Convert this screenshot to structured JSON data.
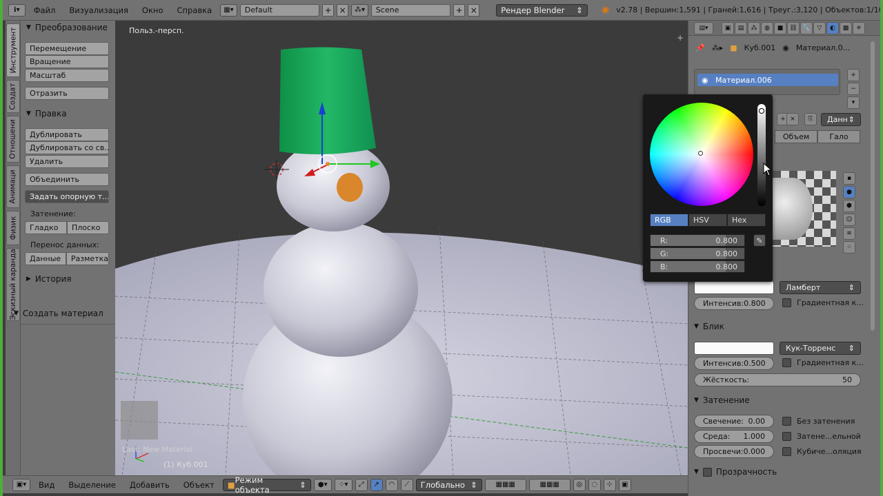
{
  "topbar": {
    "menus": [
      "Файл",
      "Визуализация",
      "Окно",
      "Справка"
    ],
    "screen_layout": "Default",
    "scene": "Scene",
    "render_engine": "Рендер Blender",
    "stats": "v2.78 | Вершин:1,591 | Граней:1,616 | Треуг.:3,120 | Объектов:1/10 | Л"
  },
  "tabs": [
    "Инструмент",
    "Создат",
    "Отношени",
    "Анимаци",
    "Физик",
    "Эскизный каранда"
  ],
  "toolshelf": {
    "transform_title": "Преобразование",
    "translate": "Перемещение",
    "rotate": "Вращение",
    "scale": "Масштаб",
    "mirror": "Отразить",
    "edit_title": "Правка",
    "duplicate": "Дублировать",
    "duplicate_linked": "Дублировать со св...",
    "delete": "Удалить",
    "join": "Объединить",
    "set_origin": "Задать опорную т...",
    "shading_label": "Затенение:",
    "smooth": "Гладко",
    "flat": "Плоско",
    "data_transfer_label": "Перенос данных:",
    "data": "Данные",
    "layout": "Разметка",
    "history": "История",
    "new_material": "Создать материал"
  },
  "viewport": {
    "view_label": "Польз.-персп.",
    "last_op": "Last: New Material",
    "object_label": "(1) Куб.001"
  },
  "bottombar": {
    "menus": [
      "Вид",
      "Выделение",
      "Добавить",
      "Объект"
    ],
    "mode": "Режим объекта",
    "orientation": "Глобально"
  },
  "props": {
    "object_name": "Куб.001",
    "material_name": "Материал.0...",
    "slot_material": "Материал.006",
    "data_dropdown": "Данн",
    "tabs": [
      "Объем",
      "Гало"
    ],
    "diffuse_shader": "Ламберт",
    "diffuse_intensity": "Интенсив:0.800",
    "gradient_1": "Градиентная к...",
    "specular_title": "Блик",
    "specular_shader": "Кук-Торренс",
    "specular_intensity": "Интенсив:0.500",
    "gradient_2": "Градиентная к...",
    "hardness_label": "Жёсткость:",
    "hardness_value": "50",
    "shading_title": "Затенение",
    "emit_label": "Свечение:",
    "emit_value": "0.00",
    "ambient_label": "Среда:",
    "ambient_value": "1.000",
    "translucency_label": "Просвечи:",
    "translucency_value": "0.000",
    "shadeless": "Без затенения",
    "tangent_shading": "Затене...ельной",
    "cubic": "Кубиче...оляция",
    "transparency_title": "Прозрачность"
  },
  "picker": {
    "modes": [
      "RGB",
      "HSV",
      "Hex"
    ],
    "active_mode": "RGB",
    "r_label": "R:",
    "r_value": "0.800",
    "g_label": "G:",
    "g_value": "0.800",
    "b_label": "B:",
    "b_value": "0.800"
  },
  "colors": {
    "accent": "#5680c2",
    "hat": "#1aa55a",
    "nose": "#e08a2c",
    "frame": "#4caf3a"
  }
}
